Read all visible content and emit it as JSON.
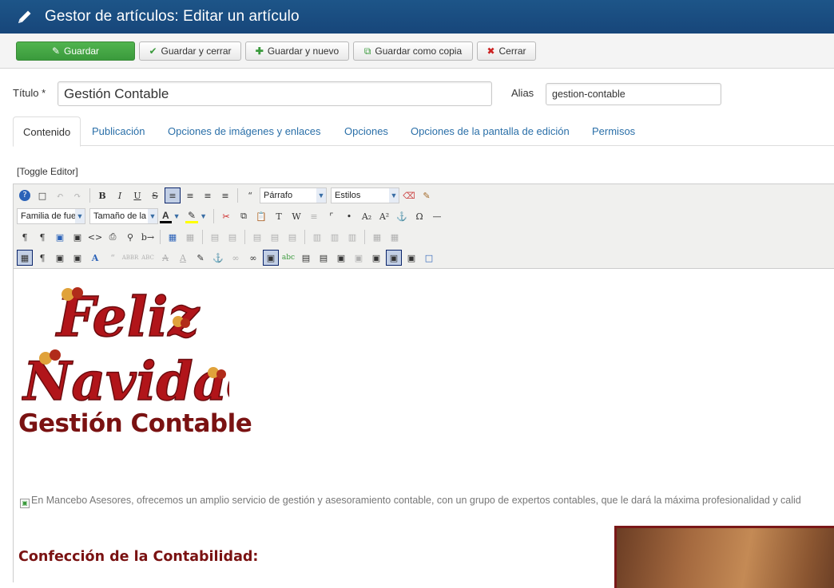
{
  "header": {
    "title": "Gestor de artículos: Editar un artículo",
    "icon": "pencil-icon"
  },
  "toolbar": {
    "save": "Guardar",
    "save_close": "Guardar y cerrar",
    "save_new": "Guardar y nuevo",
    "save_copy": "Guardar como copia",
    "close": "Cerrar"
  },
  "form": {
    "title_label": "Título *",
    "title_value": "Gestión Contable",
    "alias_label": "Alias",
    "alias_value": "gestion-contable"
  },
  "tabs": [
    {
      "label": "Contenido",
      "active": true
    },
    {
      "label": "Publicación"
    },
    {
      "label": "Opciones de imágenes y enlaces"
    },
    {
      "label": "Opciones"
    },
    {
      "label": "Opciones de la pantalla de edición"
    },
    {
      "label": "Permisos"
    }
  ],
  "editor": {
    "toggle": "[Toggle Editor]",
    "format_select": "Párrafo",
    "styles_select": "Estilos",
    "font_family_select": "Familia de fue",
    "font_size_select": "Tamaño de la"
  },
  "content": {
    "banner_line1": "Feliz",
    "banner_line2": "Navidad",
    "heading": "Gestión Contable",
    "paragraph": "En Mancebo Asesores, ofrecemos un amplio servicio de gestión y asesoramiento contable, con un grupo de expertos contables, que le dará la máxima profesionalidad y calid",
    "subheading": "Confección de la Contabilidad:"
  },
  "colors": {
    "header_bg": "#1d5588",
    "primary_button": "#46a846",
    "link": "#2a6fa8",
    "heading": "#7a1212"
  }
}
